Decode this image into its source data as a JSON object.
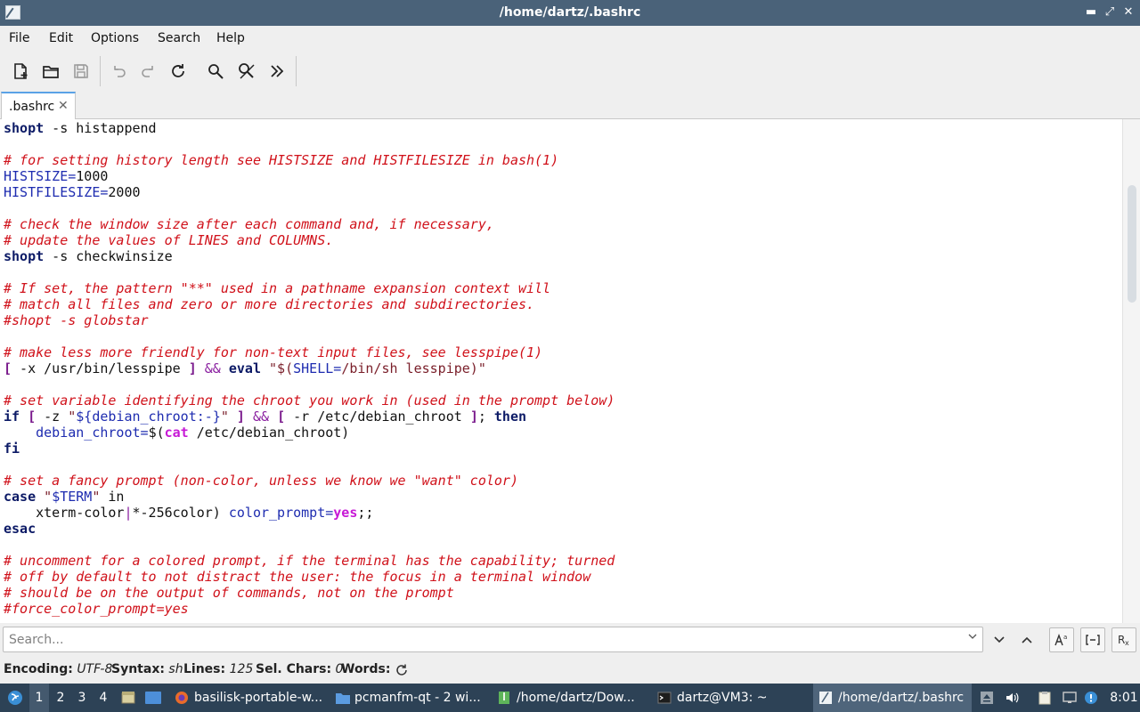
{
  "window": {
    "title": "/home/dartz/.bashrc",
    "controls": {
      "minimize": "▬",
      "maximize": "⤢",
      "close": "✕"
    }
  },
  "menu": [
    "File",
    "Edit",
    "Options",
    "Search",
    "Help"
  ],
  "toolbar": {
    "icons": [
      "new-document-icon",
      "open-folder-icon",
      "save-icon",
      "undo-icon",
      "redo-icon",
      "reload-icon",
      "find-icon",
      "find-replace-icon",
      "more-icon"
    ]
  },
  "tabs": [
    {
      "label": ".bashrc",
      "close": "✕"
    }
  ],
  "editor": {
    "colors": {
      "keyword": "#0c1a66",
      "variable": "#1e2cb0",
      "comment": "#d0111a",
      "string": "#7a1f2a",
      "bracket": "#7a1a8c",
      "magenta": "#c71ad6"
    },
    "lines": [
      [
        [
          "kw",
          "shopt"
        ],
        [
          "pl",
          " -s histappend"
        ]
      ],
      [],
      [
        [
          "cm",
          "# for setting history length see HISTSIZE and HISTFILESIZE in bash(1)"
        ]
      ],
      [
        [
          "var",
          "HISTSIZE="
        ],
        [
          "pl",
          "1000"
        ]
      ],
      [
        [
          "var",
          "HISTFILESIZE="
        ],
        [
          "pl",
          "2000"
        ]
      ],
      [],
      [
        [
          "cm",
          "# check the window size after each command and, if necessary,"
        ]
      ],
      [
        [
          "cm",
          "# update the values of LINES and COLUMNS."
        ]
      ],
      [
        [
          "kw",
          "shopt"
        ],
        [
          "pl",
          " -s checkwinsize"
        ]
      ],
      [],
      [
        [
          "cm",
          "# If set, the pattern \"**\" used in a pathname expansion context will"
        ]
      ],
      [
        [
          "cm",
          "# match all files and zero or more directories and subdirectories."
        ]
      ],
      [
        [
          "cm",
          "#shopt -s globstar"
        ]
      ],
      [],
      [
        [
          "cm",
          "# make less more friendly for non-text input files, see lesspipe(1)"
        ]
      ],
      [
        [
          "br",
          "["
        ],
        [
          "pl",
          " -x /usr/bin/lesspipe "
        ],
        [
          "br",
          "]"
        ],
        [
          "pl",
          " "
        ],
        [
          "op",
          "&&"
        ],
        [
          "pl",
          " "
        ],
        [
          "kw",
          "eval"
        ],
        [
          "pl",
          " "
        ],
        [
          "str",
          "\"$("
        ],
        [
          "var",
          "SHELL="
        ],
        [
          "str",
          "/bin/sh lesspipe)\""
        ]
      ],
      [],
      [
        [
          "cm",
          "# set variable identifying the chroot you work in (used in the prompt below)"
        ]
      ],
      [
        [
          "kw",
          "if"
        ],
        [
          "pl",
          " "
        ],
        [
          "br",
          "["
        ],
        [
          "pl",
          " -z "
        ],
        [
          "str",
          "\""
        ],
        [
          "var",
          "${debian_chroot:-}"
        ],
        [
          "str",
          "\""
        ],
        [
          "pl",
          " "
        ],
        [
          "br",
          "]"
        ],
        [
          "pl",
          " "
        ],
        [
          "op",
          "&&"
        ],
        [
          "pl",
          " "
        ],
        [
          "br",
          "["
        ],
        [
          "pl",
          " -r /etc/debian_chroot "
        ],
        [
          "br",
          "]"
        ],
        [
          "pl",
          "; "
        ],
        [
          "kw",
          "then"
        ]
      ],
      [
        [
          "pl",
          "    "
        ],
        [
          "var",
          "debian_chroot="
        ],
        [
          "pl",
          "$("
        ],
        [
          "mag",
          "cat"
        ],
        [
          "pl",
          " /etc/debian_chroot)"
        ]
      ],
      [
        [
          "kw",
          "fi"
        ]
      ],
      [],
      [
        [
          "cm",
          "# set a fancy prompt (non-color, unless we know we \"want\" color)"
        ]
      ],
      [
        [
          "kw",
          "case"
        ],
        [
          "pl",
          " "
        ],
        [
          "str",
          "\""
        ],
        [
          "var",
          "$TERM"
        ],
        [
          "str",
          "\""
        ],
        [
          "pl",
          " in"
        ]
      ],
      [
        [
          "pl",
          "    xterm-color"
        ],
        [
          "op",
          "|"
        ],
        [
          "pl",
          "*-256color) "
        ],
        [
          "var",
          "color_prompt="
        ],
        [
          "mag",
          "yes"
        ],
        [
          "pl",
          ";;"
        ]
      ],
      [
        [
          "kw",
          "esac"
        ]
      ],
      [],
      [
        [
          "cm",
          "# uncomment for a colored prompt, if the terminal has the capability; turned"
        ]
      ],
      [
        [
          "cm",
          "# off by default to not distract the user: the focus in a terminal window"
        ]
      ],
      [
        [
          "cm",
          "# should be on the output of commands, not on the prompt"
        ]
      ],
      [
        [
          "cm",
          "#force_color_prompt=yes"
        ]
      ]
    ]
  },
  "search": {
    "placeholder": "Search...",
    "value": "",
    "buttons": [
      "find-next-icon",
      "find-previous-icon",
      "match-case-icon",
      "whole-word-icon",
      "regex-icon"
    ]
  },
  "status": {
    "encoding_label": "Encoding:",
    "encoding": "UTF-8",
    "syntax_label": "Syntax:",
    "syntax": "sh",
    "lines_label": "Lines:",
    "lines": "125",
    "sel_label": "Sel. Chars:",
    "sel": "0",
    "words_label": "Words:"
  },
  "taskbar": {
    "workspaces": [
      "1",
      "2",
      "3",
      "4"
    ],
    "active_workspace": "1",
    "tasks": [
      {
        "label": "basilisk-portable-w...",
        "icon": "browser-icon"
      },
      {
        "label": "pcmanfm-qt - 2 wi...",
        "icon": "folder-icon"
      },
      {
        "label": "/home/dartz/Dow...",
        "icon": "archive-icon"
      },
      {
        "label": "dartz@VM3: ~",
        "icon": "terminal-icon"
      },
      {
        "label": "/home/dartz/.bashrc",
        "icon": "editor-icon"
      }
    ],
    "active_task": "/home/dartz/.bashrc",
    "clock": "8:01"
  }
}
